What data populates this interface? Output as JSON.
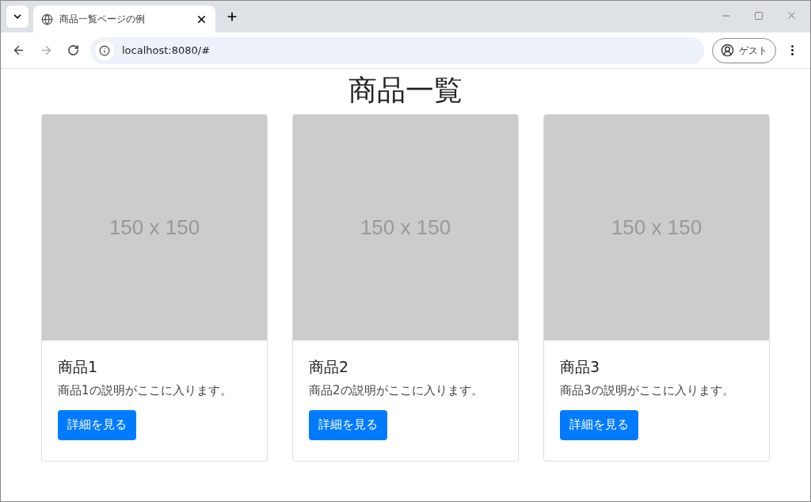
{
  "browser": {
    "tab": {
      "title": "商品一覧ページの例",
      "selected": true
    },
    "address": "localhost:8080/#",
    "profile": "ゲスト"
  },
  "page": {
    "heading": "商品一覧",
    "cards": [
      {
        "image_label": "150 x 150",
        "title": "商品1",
        "description": "商品1の説明がここに入ります。",
        "button": "詳細を見る"
      },
      {
        "image_label": "150 x 150",
        "title": "商品2",
        "description": "商品2の説明がここに入ります。",
        "button": "詳細を見る"
      },
      {
        "image_label": "150 x 150",
        "title": "商品3",
        "description": "商品3の説明がここに入ります。",
        "button": "詳細を見る"
      }
    ]
  }
}
